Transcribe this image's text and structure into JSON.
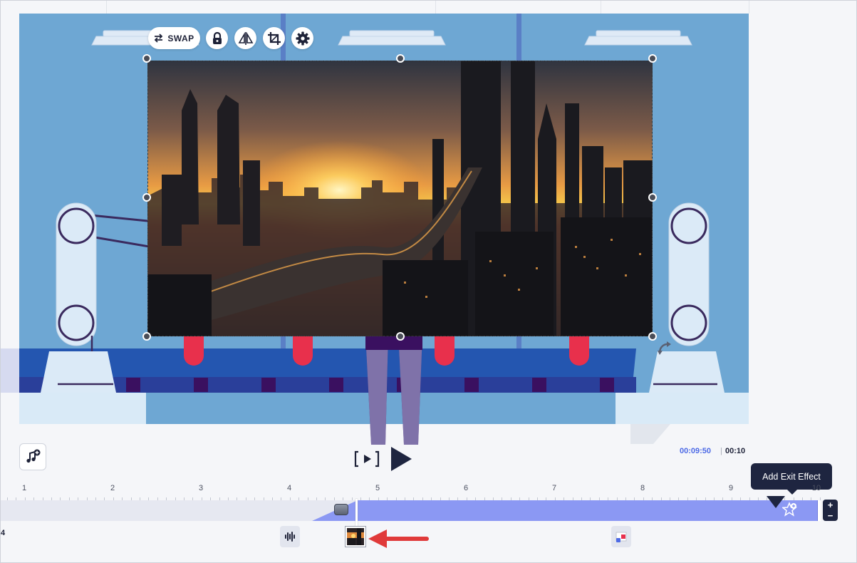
{
  "toolbar": {
    "swap_label": "SWAP",
    "icons": [
      "swap-icon",
      "lock-icon",
      "flip-icon",
      "crop-icon",
      "gear-icon"
    ]
  },
  "player": {
    "current_time": "00:09:50",
    "separator": "|",
    "total_time": "00:10"
  },
  "tooltip": {
    "text": "Add Exit Effect"
  },
  "timeline": {
    "ruler": [
      "1",
      "2",
      "3",
      "4",
      "5",
      "6",
      "7",
      "8",
      "9",
      "10"
    ],
    "left_label": "4"
  },
  "colors": {
    "canvas_bg": "#6ea7d3",
    "belt": "#2150a8",
    "accent_red": "#e8304c",
    "clip": "#8b98f3",
    "dark": "#1e2540",
    "time_blue": "#4d6ae6"
  }
}
